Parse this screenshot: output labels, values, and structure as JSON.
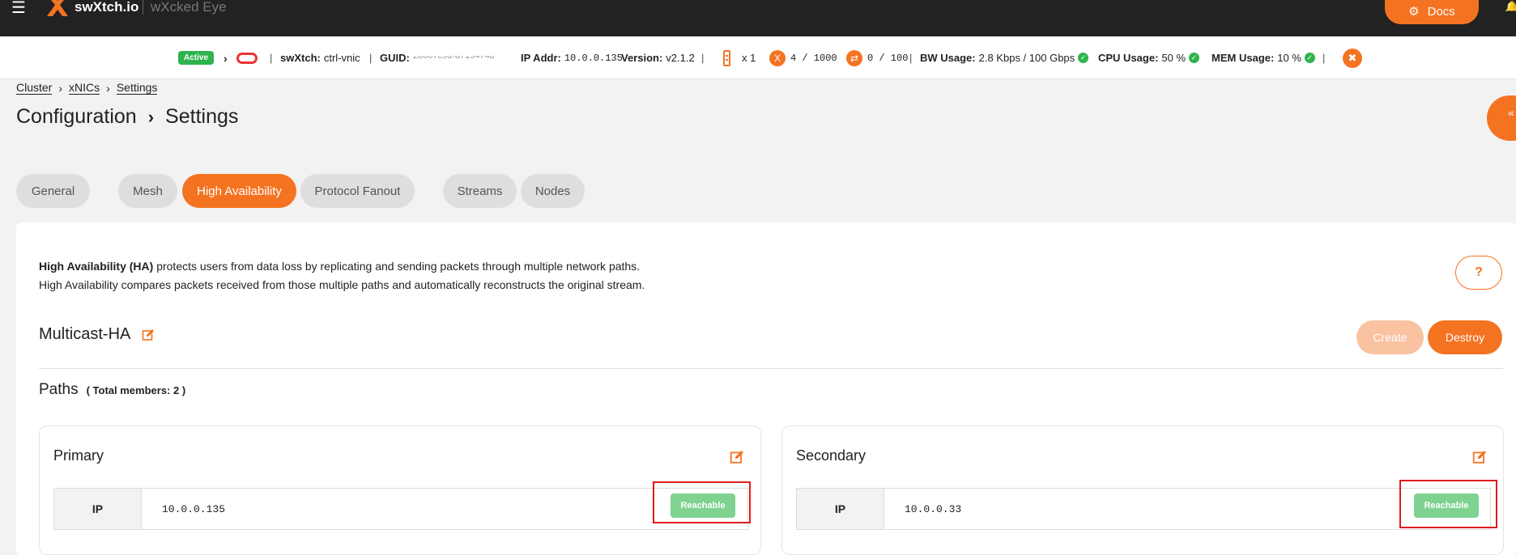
{
  "app": {
    "brand": "swXtch.io",
    "sub": "wXcked Eye",
    "docs_label": "Docs"
  },
  "status": {
    "active": "Active",
    "swxtch_label": "swXtch:",
    "swxtch_value": "ctrl-vnic",
    "guid_label": "GUID:",
    "guid_value": "2b607c9d-a719474b",
    "ip_label": "IP Addr:",
    "ip_value": "10.0.0.135",
    "version_label": "Version:",
    "version_value": "v2.1.2",
    "servers_value": "x 1",
    "xnics_value": "4 / 1000",
    "bridges_value": "0 / 100",
    "bw_label": "BW Usage:",
    "bw_value": "2.8 Kbps / 100 Gbps",
    "cpu_label": "CPU Usage:",
    "cpu_value": "50 %",
    "mem_label": "MEM Usage:",
    "mem_value": "10 %"
  },
  "breadcrumb": [
    "Cluster",
    "xNICs",
    "Settings"
  ],
  "title": {
    "parent": "Configuration",
    "current": "Settings"
  },
  "tabs": [
    "General",
    "Mesh",
    "High Availability",
    "Protocol Fanout",
    "Streams",
    "Nodes"
  ],
  "active_tab": "High Availability",
  "description": {
    "bold": "High Availability (HA)",
    "line1_rest": " protects users from data loss by replicating and sending packets through multiple network paths.",
    "line2": "High Availability compares packets received from those multiple paths and automatically reconstructs the original stream."
  },
  "help_label": "?",
  "section": {
    "title": "Multicast-HA",
    "create_label": "Create",
    "destroy_label": "Destroy"
  },
  "paths": {
    "title": "Paths",
    "members": "( Total members: 2 )",
    "items": [
      {
        "name": "Primary",
        "ip_label": "IP",
        "ip": "10.0.0.135",
        "status": "Reachable"
      },
      {
        "name": "Secondary",
        "ip_label": "IP",
        "ip": "10.0.0.33",
        "status": "Reachable"
      }
    ]
  },
  "colors": {
    "accent": "#f47321",
    "ok": "#2fb34e",
    "reachable": "#7fd28f",
    "highlight": "#e01b1b"
  }
}
